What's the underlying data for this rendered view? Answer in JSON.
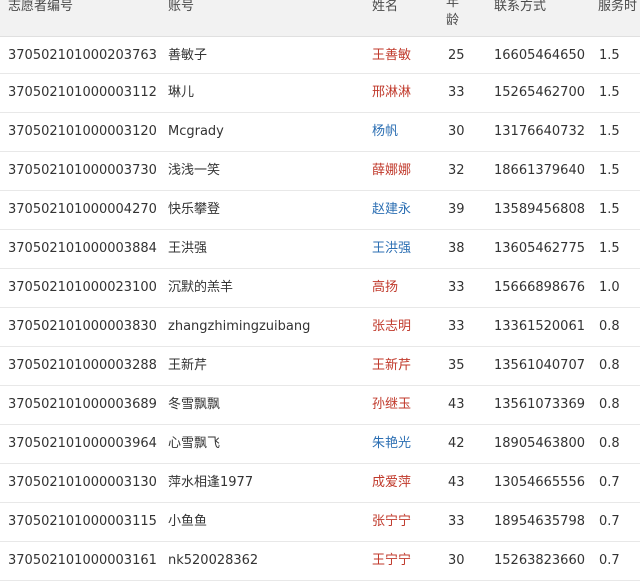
{
  "table": {
    "headers": [
      "志愿者编号",
      "账号",
      "姓名",
      "年龄",
      "联系方式",
      "服务时"
    ],
    "rows": [
      {
        "id": "370502101000203763",
        "account": "善敏子",
        "name": "王善敏",
        "gender_color": "f",
        "age": "25",
        "phone": "16605464650",
        "hours": "1.5"
      },
      {
        "id": "370502101000003112",
        "account": "琳儿",
        "name": "邢淋淋",
        "gender_color": "f",
        "age": "33",
        "phone": "15265462700",
        "hours": "1.5"
      },
      {
        "id": "370502101000003120",
        "account": "Mcgrady",
        "name": "杨帆",
        "gender_color": "m",
        "age": "30",
        "phone": "13176640732",
        "hours": "1.5"
      },
      {
        "id": "370502101000003730",
        "account": "浅浅一笑",
        "name": "薛娜娜",
        "gender_color": "f",
        "age": "32",
        "phone": "18661379640",
        "hours": "1.5"
      },
      {
        "id": "370502101000004270",
        "account": "快乐攀登",
        "name": "赵建永",
        "gender_color": "m",
        "age": "39",
        "phone": "13589456808",
        "hours": "1.5"
      },
      {
        "id": "370502101000003884",
        "account": "王洪强",
        "name": "王洪强",
        "gender_color": "m",
        "age": "38",
        "phone": "13605462775",
        "hours": "1.5"
      },
      {
        "id": "370502101000023100",
        "account": "沉默的羔羊",
        "name": "高扬",
        "gender_color": "f",
        "age": "33",
        "phone": "15666898676",
        "hours": "1.0"
      },
      {
        "id": "370502101000003830",
        "account": "zhangzhimingzuibang",
        "name": "张志明",
        "gender_color": "f",
        "age": "33",
        "phone": "13361520061",
        "hours": "0.8"
      },
      {
        "id": "370502101000003288",
        "account": "王新芹",
        "name": "王新芹",
        "gender_color": "f",
        "age": "35",
        "phone": "13561040707",
        "hours": "0.8"
      },
      {
        "id": "370502101000003689",
        "account": "冬雪飘飘",
        "name": "孙继玉",
        "gender_color": "f",
        "age": "43",
        "phone": "13561073369",
        "hours": "0.8"
      },
      {
        "id": "370502101000003964",
        "account": "心雪飘飞",
        "name": "朱艳光",
        "gender_color": "m",
        "age": "42",
        "phone": "18905463800",
        "hours": "0.8"
      },
      {
        "id": "370502101000003130",
        "account": "萍水相逢1977",
        "name": "成爱萍",
        "gender_color": "f",
        "age": "43",
        "phone": "13054665556",
        "hours": "0.7"
      },
      {
        "id": "370502101000003115",
        "account": "小鱼鱼",
        "name": "张宁宁",
        "gender_color": "f",
        "age": "33",
        "phone": "18954635798",
        "hours": "0.7"
      },
      {
        "id": "370502101000003161",
        "account": "nk520028362",
        "name": "王宁宁",
        "gender_color": "f",
        "age": "30",
        "phone": "15263823660",
        "hours": "0.7"
      }
    ]
  },
  "colors": {
    "female_name": "#c0392b",
    "male_name": "#2c6fb3",
    "header_bg": "#f2f2f2"
  }
}
